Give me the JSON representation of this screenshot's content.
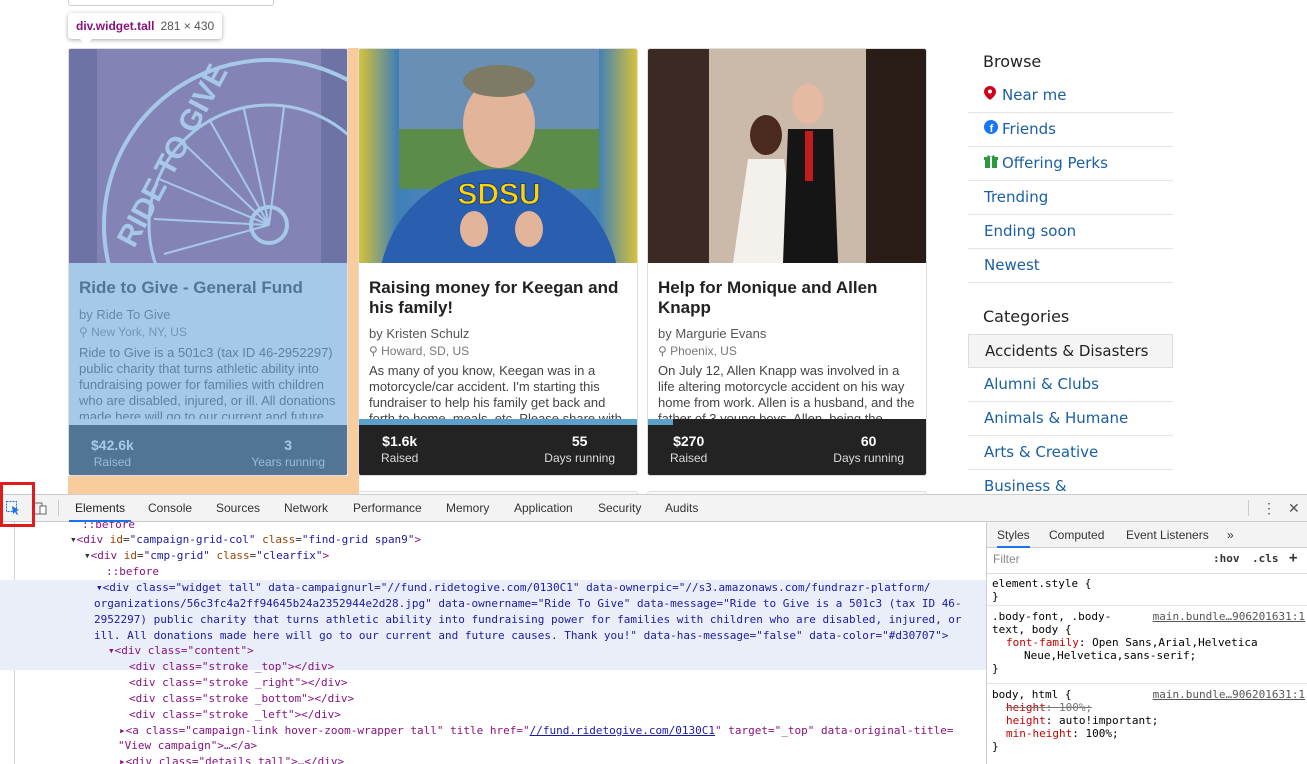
{
  "tooltip": {
    "selector": "div.widget.tall",
    "dims": "281 × 430"
  },
  "cards": [
    {
      "title": "Ride to Give - General Fund",
      "owner": "by Ride To Give",
      "location": "New York, NY, US",
      "description": "Ride to Give is a 501c3 (tax ID 46-2952297) public charity that turns athletic ability into fundraising power for families with children who are disabled, injured, or ill. All donations made here will go to our current and future",
      "stat1_value": "$42.6k",
      "stat1_label": "Raised",
      "stat2_value": "3",
      "stat2_label": "Years running",
      "logo_text": "RIDE TO GIVE",
      "progress": 0
    },
    {
      "title": "Raising money for Keegan and his family!",
      "owner": "by Kristen Schulz",
      "location": "Howard, SD, US",
      "description": "As many of you know, Keegan was in a motorcycle/car accident. I'm starting this fundraiser to help his family get back and forth to home, meals, etc. Please share with",
      "stat1_value": "$1.6k",
      "stat1_label": "Raised",
      "stat2_value": "55",
      "stat2_label": "Days running",
      "shirt_text": "SDSU",
      "progress": 100
    },
    {
      "title": "Help for Monique and Allen Knapp",
      "owner": "by Margurie Evans",
      "location": "Phoenix, US",
      "description": "On July 12, Allen Knapp was involved in a life altering motorcycle accident on his way home from work. Allen is a husband, and the father of 3 young boys. Allen, being the",
      "stat1_value": "$270",
      "stat1_label": "Raised",
      "stat2_value": "60",
      "stat2_label": "Days running",
      "progress": 9
    }
  ],
  "sidebar": {
    "browse_heading": "Browse",
    "browse": [
      {
        "label": "Near me",
        "icon": "map-marker-icon",
        "color": "#d0021b"
      },
      {
        "label": "Friends",
        "icon": "facebook-icon",
        "color": "#3b5998"
      },
      {
        "label": "Offering Perks",
        "icon": "gift-icon",
        "color": "#2b9a3e"
      },
      {
        "label": "Trending"
      },
      {
        "label": "Ending soon"
      },
      {
        "label": "Newest"
      }
    ],
    "categories_heading": "Categories",
    "categories": [
      {
        "label": "Accidents & Disasters",
        "active": true
      },
      {
        "label": "Alumni & Clubs"
      },
      {
        "label": "Animals & Humane"
      },
      {
        "label": "Arts & Creative"
      },
      {
        "label": "Business &"
      }
    ]
  },
  "devtools": {
    "tabs": [
      "Elements",
      "Console",
      "Sources",
      "Network",
      "Performance",
      "Memory",
      "Application",
      "Security",
      "Audits"
    ],
    "active_tab": "Elements",
    "styles_tabs": [
      "Styles",
      "Computed",
      "Event Listeners"
    ],
    "filter_placeholder": "Filter",
    "hov": ":hov",
    "cls": ".cls",
    "dom": {
      "before0": "::before",
      "l1_tag": "div",
      "l1_id": "campaign-grid-col",
      "l1_class": "find-grid span9",
      "l2_tag": "div",
      "l2_id": "cmp-grid",
      "l2_class": "clearfix",
      "before1": "::before",
      "sel_1": "<div class=\"widget tall\" data-campaignurl=\"//fund.ridetogive.com/0130C1\" data-ownerpic=\"//s3.amazonaws.com/fundrazr-platform/",
      "sel_2": "organizations/56c3fc4a2ff94645b24a2352944e2d28.jpg\" data-ownername=\"Ride To Give\" data-message=\"Ride to Give is a 501c3 (tax ID 46-",
      "sel_3": "2952297) public charity that turns athletic ability into fundraising power for families with children who are disabled, injured, or",
      "sel_4": "ill. All donations made here will go to our current and future causes. Thank you!\" data-has-message=\"false\" data-color=\"#d30707\">",
      "content": "<div class=\"content\">",
      "stroke_top": "<div class=\"stroke _top\"></div>",
      "stroke_right": "<div class=\"stroke _right\"></div>",
      "stroke_bottom": "<div class=\"stroke _bottom\"></div>",
      "stroke_left": "<div class=\"stroke _left\"></div>",
      "a_line_1": "<a class=\"campaign-link hover-zoom-wrapper tall\" title href=\"",
      "a_link": "//fund.ridetogive.com/0130C1",
      "a_line_2": "\" target=\"_top\" data-original-title=",
      "a_line_3": "\"View campaign\">…</a>",
      "details": "<div class=\"details tall\">…</div>"
    },
    "styles": {
      "element_style": "element.style {",
      "close": "}",
      "rule1_selector_a": ".body-font, .body-",
      "rule1_selector_b": "text, body {",
      "rule1_src": "main.bundle…906201631:1",
      "rule1_prop": "font-family",
      "rule1_val_a": "Open Sans,Arial,Helvetica",
      "rule1_val_b": "Neue,Helvetica,sans-serif;",
      "rule2_selector": "body, html {",
      "rule2_src": "main.bundle…906201631:1",
      "rule2_p1": "height",
      "rule2_v1": "100%;",
      "rule2_p2": "height",
      "rule2_v2": "auto!important;",
      "rule2_p3": "min-height",
      "rule2_v3": "100%;"
    }
  }
}
